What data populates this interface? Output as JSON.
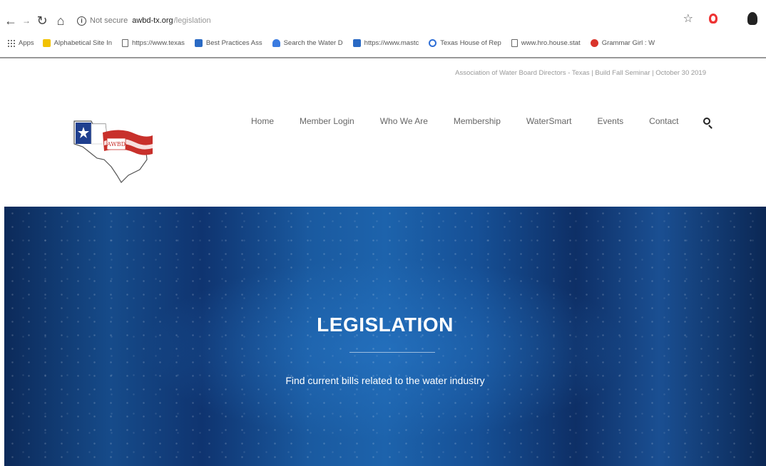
{
  "browser": {
    "security_label": "Not secure",
    "url_host": "awbd-tx.org",
    "url_path": "/legislation",
    "bookmarks": [
      {
        "label": "Apps",
        "icon": "apps-grid-icon"
      },
      {
        "label": "Alphabetical Site In",
        "icon": "folder-icon"
      },
      {
        "label": "https://www.texas",
        "icon": "page-icon"
      },
      {
        "label": "Best Practices Ass",
        "icon": "site-icon"
      },
      {
        "label": "Search the Water D",
        "icon": "site-icon"
      },
      {
        "label": "https://www.mastc",
        "icon": "site-icon"
      },
      {
        "label": "Texas House of Rep",
        "icon": "search-site-icon"
      },
      {
        "label": "www.hro.house.stat",
        "icon": "page-icon"
      },
      {
        "label": "Grammar Girl : W",
        "icon": "site-icon"
      }
    ]
  },
  "site": {
    "topbar_text": "Association of Water Board Directors - Texas | Build Fall Seminar | October 30 2019",
    "nav": [
      "Home",
      "Member Login",
      "Who We Are",
      "Membership",
      "WaterSmart",
      "Events",
      "Contact"
    ],
    "logo_text": "AWBD",
    "colors": {
      "brand_red": "#c8302b",
      "brand_blue": "#1f3f8f",
      "hero_blue": "#164b8a"
    }
  },
  "hero": {
    "title": "LEGISLATION",
    "subtitle": "Find current bills related to the water industry"
  }
}
